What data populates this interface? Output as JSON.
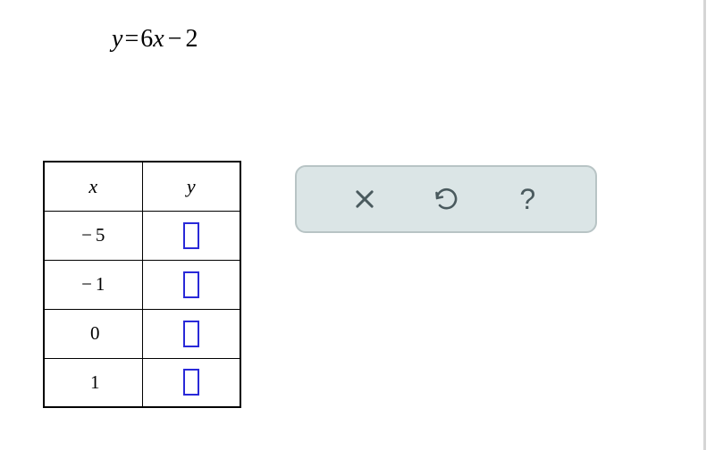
{
  "equation": {
    "lhs_var": "y",
    "eq": "=",
    "coef": "6",
    "rhs_var": "x",
    "op": "−",
    "const": "2"
  },
  "table": {
    "headers": {
      "x": "x",
      "y": "y"
    },
    "rows": [
      {
        "x_prefix": "−",
        "x": "5",
        "y": ""
      },
      {
        "x_prefix": "−",
        "x": "1",
        "y": ""
      },
      {
        "x_prefix": "",
        "x": "0",
        "y": ""
      },
      {
        "x_prefix": "",
        "x": "1",
        "y": ""
      }
    ]
  },
  "toolbar": {
    "clear": "clear-icon",
    "reset": "reset-icon",
    "help": "?"
  }
}
